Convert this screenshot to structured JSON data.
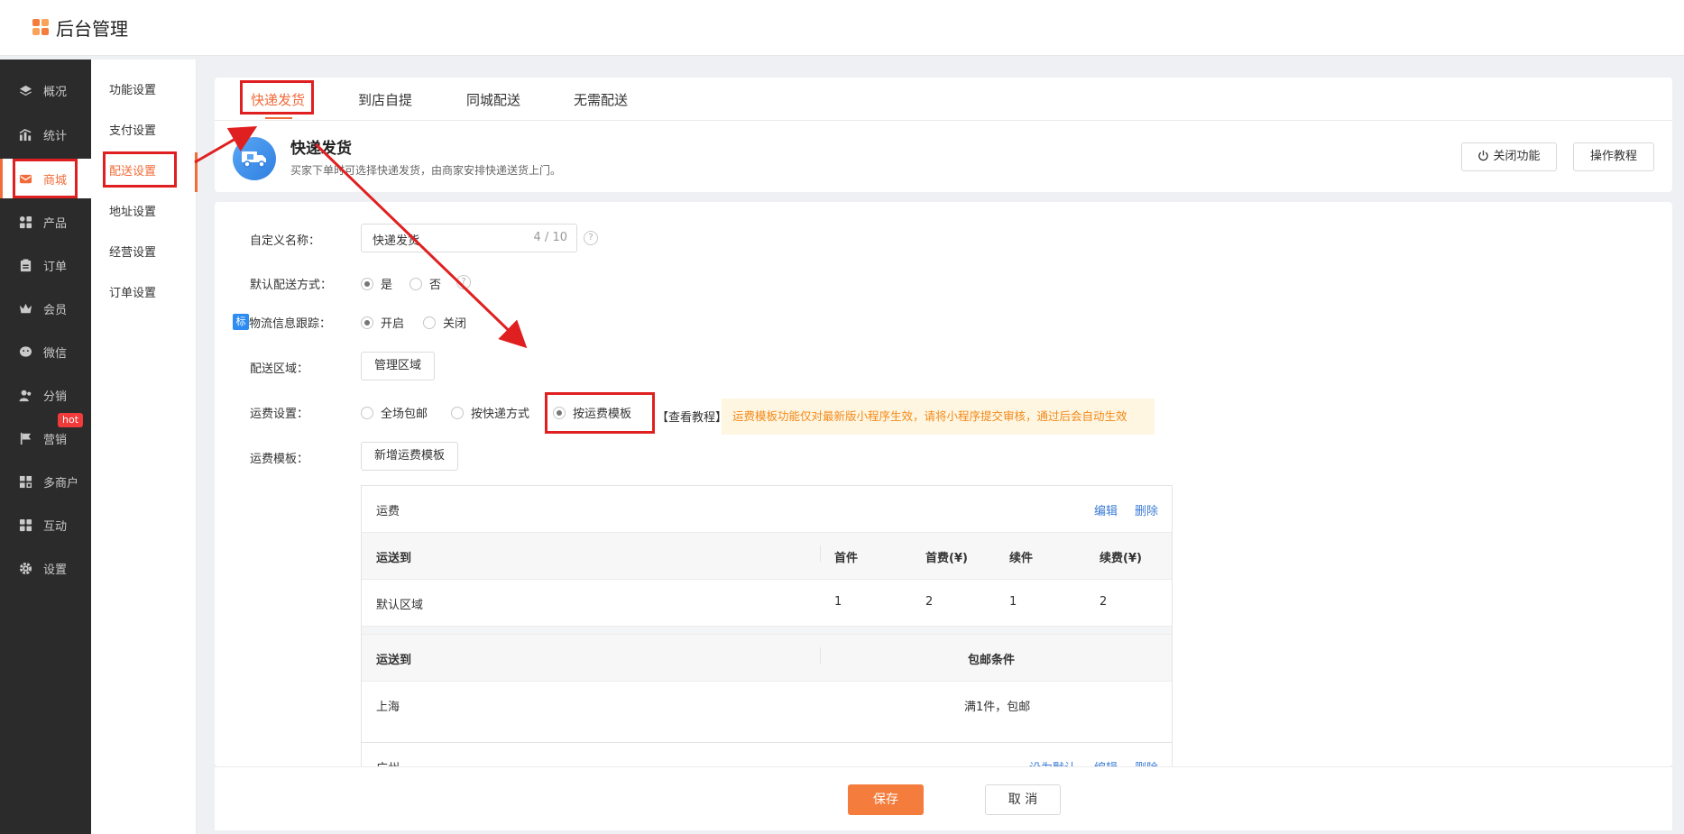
{
  "app": {
    "title": "后台管理"
  },
  "nav": {
    "items": [
      {
        "label": "概况",
        "icon": "layers-icon"
      },
      {
        "label": "统计",
        "icon": "chart-icon"
      },
      {
        "label": "商城",
        "icon": "mail-icon",
        "active": true
      },
      {
        "label": "产品",
        "icon": "grid-icon"
      },
      {
        "label": "订单",
        "icon": "clipboard-icon"
      },
      {
        "label": "会员",
        "icon": "crown-icon"
      },
      {
        "label": "微信",
        "icon": "wechat-icon"
      },
      {
        "label": "分销",
        "icon": "users-icon"
      },
      {
        "label": "营销",
        "icon": "flag-icon"
      },
      {
        "label": "多商户",
        "icon": "store-icon"
      },
      {
        "label": "互动",
        "icon": "apps-icon"
      },
      {
        "label": "设置",
        "icon": "gear-icon"
      }
    ],
    "hot_badge": "hot"
  },
  "subnav": {
    "items": [
      "功能设置",
      "支付设置",
      "配送设置",
      "地址设置",
      "经营设置",
      "订单设置"
    ],
    "active": "配送设置"
  },
  "tabs": [
    "快递发货",
    "到店自提",
    "同城配送",
    "无需配送"
  ],
  "method": {
    "title": "快递发货",
    "desc": "买家下单时可选择快递发货，由商家安排快递送货上门。",
    "close_btn": "关闭功能",
    "tutorial_btn": "操作教程"
  },
  "form": {
    "custom_name_label": "自定义名称：",
    "custom_name_value": "快递发货",
    "custom_name_count": "4 / 10",
    "default_label": "默认配送方式：",
    "yes": "是",
    "no": "否",
    "tracking_badge": "标",
    "tracking_label": "物流信息跟踪：",
    "on": "开启",
    "off": "关闭",
    "region_label": "配送区域：",
    "region_btn": "管理区域",
    "fee_label": "运费设置：",
    "fee_opt1": "全场包邮",
    "fee_opt2": "按快递方式",
    "fee_opt3": "按运费模板",
    "fee_tutorial": "【查看教程】",
    "fee_tip": "运费模板功能仅对最新版小程序生效，请将小程序提交审核，通过后会自动生效",
    "template_label": "运费模板：",
    "template_btn": "新增运费模板",
    "qmark": "?"
  },
  "template_table": {
    "name": "运费",
    "edit": "编辑",
    "delete": "删除",
    "headers": [
      "运送到",
      "首件",
      "首费(¥)",
      "续件",
      "续费(¥)"
    ],
    "rows": [
      [
        "默认区域",
        "1",
        "2",
        "1",
        "2"
      ]
    ],
    "free_headers": [
      "运送到",
      "包邮条件"
    ],
    "free_rows": [
      [
        "上海",
        "满1件，包邮"
      ]
    ]
  },
  "template_table2": {
    "name": "广州",
    "set_default": "设为默认",
    "edit": "编辑",
    "delete": "删除"
  },
  "footer": {
    "save": "保存",
    "cancel": "取 消"
  }
}
